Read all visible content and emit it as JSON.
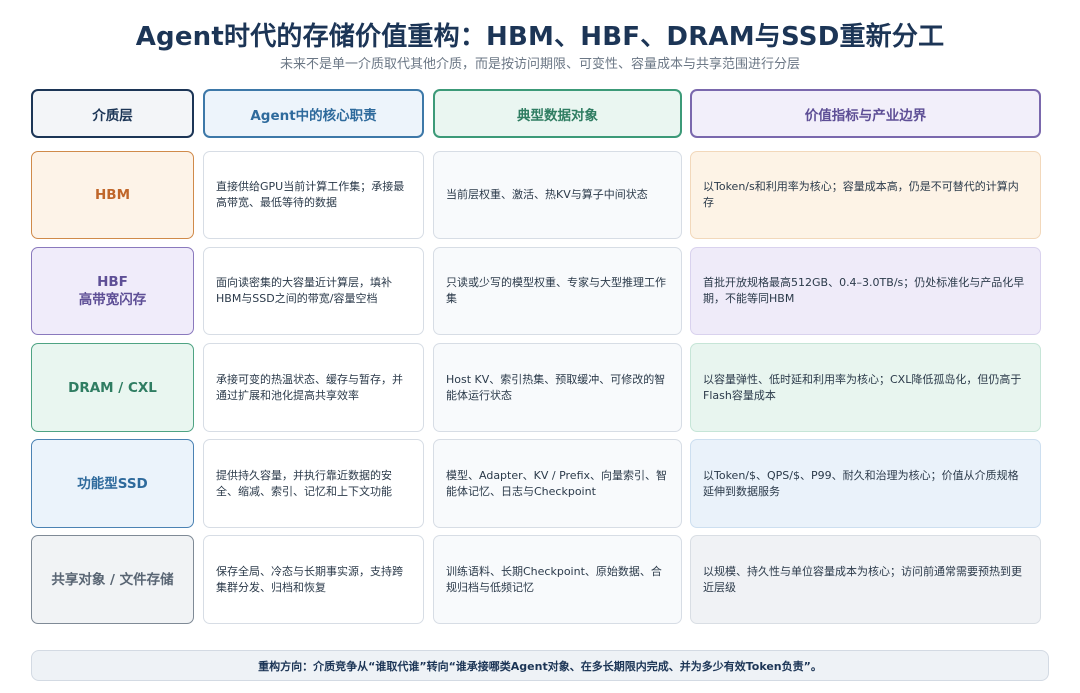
{
  "title": "Agent时代的存储价值重构：HBM、HBF、DRAM与SSD重新分工",
  "subtitle": "未来不是单一介质取代其他介质，而是按访问期限、可变性、容量成本与共享范围进行分层",
  "headers": {
    "layer": "介质层",
    "role": "Agent中的核心职责",
    "objects": "典型数据对象",
    "value": "价值指标与产业边界"
  },
  "rows": [
    {
      "layer": "HBM",
      "layer_sub": "",
      "role": "直接供给GPU当前计算工作集；承接最高带宽、最低等待的数据",
      "objects": "当前层权重、激活、热KV与算子中间状态",
      "value": "以Token/s和利用率为核心；容量成本高，仍是不可替代的计算内存"
    },
    {
      "layer": "HBF",
      "layer_sub": "高带宽闪存",
      "role": "面向读密集的大容量近计算层，填补HBM与SSD之间的带宽/容量空档",
      "objects": "只读或少写的模型权重、专家与大型推理工作集",
      "value": "首批开放规格最高512GB、0.4–3.0TB/s；仍处标准化与产品化早期，不能等同HBM"
    },
    {
      "layer": "DRAM / CXL",
      "layer_sub": "",
      "role": "承接可变的热温状态、缓存与暂存，并通过扩展和池化提高共享效率",
      "objects": "Host KV、索引热集、预取缓冲、可修改的智能体运行状态",
      "value": "以容量弹性、低时延和利用率为核心；CXL降低孤岛化，但仍高于Flash容量成本"
    },
    {
      "layer": "功能型SSD",
      "layer_sub": "",
      "role": "提供持久容量，并执行靠近数据的安全、缩减、索引、记忆和上下文功能",
      "objects": "模型、Adapter、KV / Prefix、向量索引、智能体记忆、日志与Checkpoint",
      "value": "以Token/$、QPS/$、P99、耐久和治理为核心；价值从介质规格延伸到数据服务"
    },
    {
      "layer": "共享对象 / 文件存储",
      "layer_sub": "",
      "role": "保存全局、冷态与长期事实源，支持跨集群分发、归档和恢复",
      "objects": "训练语料、长期Checkpoint、原始数据、合规归档与低频记忆",
      "value": "以规模、持久性与单位容量成本为核心；访问前通常需要预热到更近层级"
    }
  ],
  "footer": "重构方向：介质竞争从“谁取代谁”转向“谁承接哪类Agent对象、在多长期限内完成、并为多少有效Token负责”。"
}
